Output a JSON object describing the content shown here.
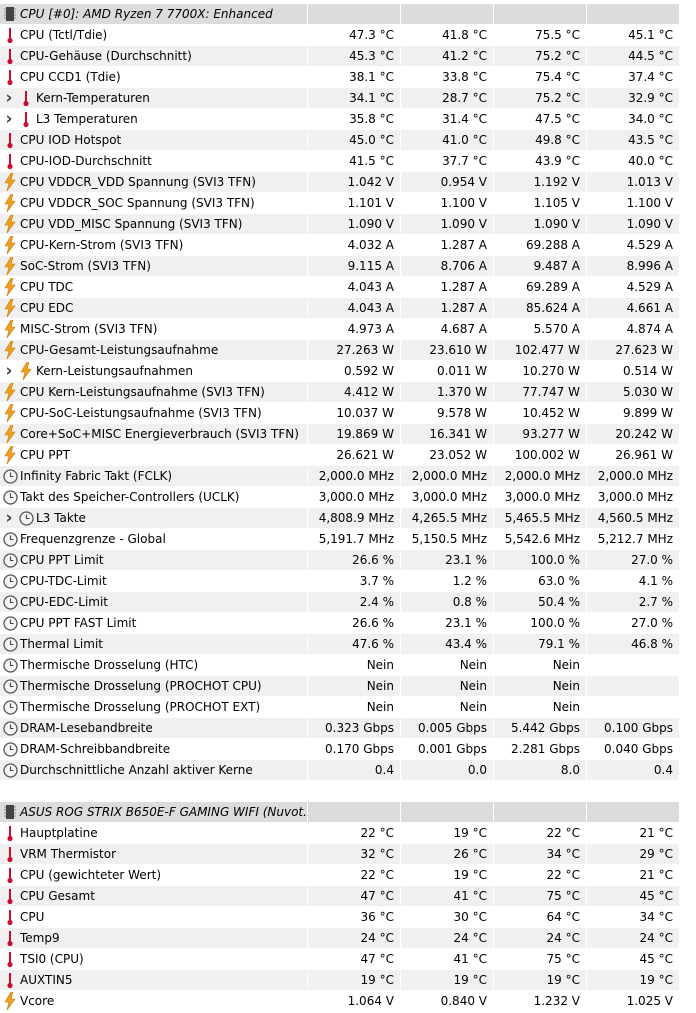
{
  "colors": {
    "row_alt": "#f0f0f0",
    "header": "#dcdcdc",
    "thermo": "#c8102e",
    "bolt": "#f0a020"
  },
  "sections": [
    {
      "title": "CPU [#0]: AMD Ryzen 7 7700X: Enhanced",
      "rows": [
        {
          "icon": "thermometer-icon",
          "label": "CPU (Tctl/Tdie)",
          "values": [
            "47.3 °C",
            "41.8 °C",
            "75.5 °C",
            "45.1 °C"
          ]
        },
        {
          "icon": "thermometer-icon",
          "label": "CPU-Gehäuse (Durchschnitt)",
          "values": [
            "45.3 °C",
            "41.2 °C",
            "75.2 °C",
            "44.5 °C"
          ]
        },
        {
          "icon": "thermometer-icon",
          "label": "CPU CCD1 (Tdie)",
          "values": [
            "38.1 °C",
            "33.8 °C",
            "75.4 °C",
            "37.4 °C"
          ]
        },
        {
          "icon": "thermometer-icon",
          "expand": true,
          "label": "Kern-Temperaturen",
          "values": [
            "34.1 °C",
            "28.7 °C",
            "75.2 °C",
            "32.9 °C"
          ]
        },
        {
          "icon": "thermometer-icon",
          "expand": true,
          "label": "L3 Temperaturen",
          "values": [
            "35.8 °C",
            "31.4 °C",
            "47.5 °C",
            "34.0 °C"
          ]
        },
        {
          "icon": "thermometer-icon",
          "label": "CPU IOD Hotspot",
          "values": [
            "45.0 °C",
            "41.0 °C",
            "49.8 °C",
            "43.5 °C"
          ]
        },
        {
          "icon": "thermometer-icon",
          "label": "CPU-IOD-Durchschnitt",
          "values": [
            "41.5 °C",
            "37.7 °C",
            "43.9 °C",
            "40.0 °C"
          ]
        },
        {
          "icon": "lightning-icon",
          "label": "CPU VDDCR_VDD Spannung (SVI3 TFN)",
          "values": [
            "1.042 V",
            "0.954 V",
            "1.192 V",
            "1.013 V"
          ]
        },
        {
          "icon": "lightning-icon",
          "label": "CPU VDDCR_SOC Spannung (SVI3 TFN)",
          "values": [
            "1.101 V",
            "1.100 V",
            "1.105 V",
            "1.100 V"
          ]
        },
        {
          "icon": "lightning-icon",
          "label": "CPU VDD_MISC Spannung (SVI3 TFN)",
          "values": [
            "1.090 V",
            "1.090 V",
            "1.090 V",
            "1.090 V"
          ]
        },
        {
          "icon": "lightning-icon",
          "label": "CPU-Kern-Strom (SVI3 TFN)",
          "values": [
            "4.032 A",
            "1.287 A",
            "69.288 A",
            "4.529 A"
          ]
        },
        {
          "icon": "lightning-icon",
          "label": "SoC-Strom (SVI3 TFN)",
          "values": [
            "9.115 A",
            "8.706 A",
            "9.487 A",
            "8.996 A"
          ]
        },
        {
          "icon": "lightning-icon",
          "label": "CPU TDC",
          "values": [
            "4.043 A",
            "1.287 A",
            "69.289 A",
            "4.529 A"
          ]
        },
        {
          "icon": "lightning-icon",
          "label": "CPU EDC",
          "values": [
            "4.043 A",
            "1.287 A",
            "85.624 A",
            "4.661 A"
          ]
        },
        {
          "icon": "lightning-icon",
          "label": "MISC-Strom (SVI3 TFN)",
          "values": [
            "4.973 A",
            "4.687 A",
            "5.570 A",
            "4.874 A"
          ]
        },
        {
          "icon": "lightning-icon",
          "label": "CPU-Gesamt-Leistungsaufnahme",
          "values": [
            "27.263 W",
            "23.610 W",
            "102.477 W",
            "27.623 W"
          ]
        },
        {
          "icon": "lightning-icon",
          "expand": true,
          "label": "Kern-Leistungsaufnahmen",
          "values": [
            "0.592 W",
            "0.011 W",
            "10.270 W",
            "0.514 W"
          ]
        },
        {
          "icon": "lightning-icon",
          "label": "CPU Kern-Leistungsaufnahme (SVI3 TFN)",
          "values": [
            "4.412 W",
            "1.370 W",
            "77.747 W",
            "5.030 W"
          ]
        },
        {
          "icon": "lightning-icon",
          "label": "CPU-SoC-Leistungsaufnahme (SVI3 TFN)",
          "values": [
            "10.037 W",
            "9.578 W",
            "10.452 W",
            "9.899 W"
          ]
        },
        {
          "icon": "lightning-icon",
          "label": "Core+SoC+MISC Energieverbrauch (SVI3 TFN)",
          "values": [
            "19.869 W",
            "16.341 W",
            "93.277 W",
            "20.242 W"
          ]
        },
        {
          "icon": "lightning-icon",
          "label": "CPU PPT",
          "values": [
            "26.621 W",
            "23.052 W",
            "100.002 W",
            "26.961 W"
          ]
        },
        {
          "icon": "clock-icon",
          "label": "Infinity Fabric Takt (FCLK)",
          "values": [
            "2,000.0 MHz",
            "2,000.0 MHz",
            "2,000.0 MHz",
            "2,000.0 MHz"
          ]
        },
        {
          "icon": "clock-icon",
          "label": "Takt des Speicher-Controllers (UCLK)",
          "values": [
            "3,000.0 MHz",
            "3,000.0 MHz",
            "3,000.0 MHz",
            "3,000.0 MHz"
          ]
        },
        {
          "icon": "clock-icon",
          "expand": true,
          "label": "L3 Takte",
          "values": [
            "4,808.9 MHz",
            "4,265.5 MHz",
            "5,465.5 MHz",
            "4,560.5 MHz"
          ]
        },
        {
          "icon": "clock-icon",
          "label": "Frequenzgrenze - Global",
          "values": [
            "5,191.7 MHz",
            "5,150.5 MHz",
            "5,542.6 MHz",
            "5,212.7 MHz"
          ]
        },
        {
          "icon": "clock-icon",
          "label": "CPU PPT Limit",
          "values": [
            "26.6 %",
            "23.1 %",
            "100.0 %",
            "27.0 %"
          ]
        },
        {
          "icon": "clock-icon",
          "label": "CPU-TDC-Limit",
          "values": [
            "3.7 %",
            "1.2 %",
            "63.0 %",
            "4.1 %"
          ]
        },
        {
          "icon": "clock-icon",
          "label": "CPU-EDC-Limit",
          "values": [
            "2.4 %",
            "0.8 %",
            "50.4 %",
            "2.7 %"
          ]
        },
        {
          "icon": "clock-icon",
          "label": "CPU PPT FAST Limit",
          "values": [
            "26.6 %",
            "23.1 %",
            "100.0 %",
            "27.0 %"
          ]
        },
        {
          "icon": "clock-icon",
          "label": "Thermal Limit",
          "values": [
            "47.6 %",
            "43.4 %",
            "79.1 %",
            "46.8 %"
          ]
        },
        {
          "icon": "clock-icon",
          "label": "Thermische Drosselung (HTC)",
          "values": [
            "Nein",
            "Nein",
            "Nein",
            ""
          ]
        },
        {
          "icon": "clock-icon",
          "label": "Thermische Drosselung (PROCHOT CPU)",
          "values": [
            "Nein",
            "Nein",
            "Nein",
            ""
          ]
        },
        {
          "icon": "clock-icon",
          "label": "Thermische Drosselung (PROCHOT EXT)",
          "values": [
            "Nein",
            "Nein",
            "Nein",
            ""
          ]
        },
        {
          "icon": "clock-icon",
          "label": "DRAM-Lesebandbreite",
          "values": [
            "0.323 Gbps",
            "0.005 Gbps",
            "5.442 Gbps",
            "0.100 Gbps"
          ]
        },
        {
          "icon": "clock-icon",
          "label": "DRAM-Schreibbandbreite",
          "values": [
            "0.170 Gbps",
            "0.001 Gbps",
            "2.281 Gbps",
            "0.040 Gbps"
          ]
        },
        {
          "icon": "clock-icon",
          "label": "Durchschnittliche Anzahl aktiver Kerne",
          "values": [
            "0.4",
            "0.0",
            "8.0",
            "0.4"
          ]
        }
      ]
    },
    {
      "title": "ASUS ROG STRIX B650E-F GAMING WIFI (Nuvot...",
      "rows": [
        {
          "icon": "thermometer-icon",
          "label": "Hauptplatine",
          "values": [
            "22 °C",
            "19 °C",
            "22 °C",
            "21 °C"
          ]
        },
        {
          "icon": "thermometer-icon",
          "label": "VRM Thermistor",
          "values": [
            "32 °C",
            "26 °C",
            "34 °C",
            "29 °C"
          ]
        },
        {
          "icon": "thermometer-icon",
          "label": "CPU (gewichteter Wert)",
          "values": [
            "22 °C",
            "19 °C",
            "22 °C",
            "21 °C"
          ]
        },
        {
          "icon": "thermometer-icon",
          "label": "CPU Gesamt",
          "values": [
            "47 °C",
            "41 °C",
            "75 °C",
            "45 °C"
          ]
        },
        {
          "icon": "thermometer-icon",
          "label": "CPU",
          "values": [
            "36 °C",
            "30 °C",
            "64 °C",
            "34 °C"
          ]
        },
        {
          "icon": "thermometer-icon",
          "label": "Temp9",
          "values": [
            "24 °C",
            "24 °C",
            "24 °C",
            "24 °C"
          ]
        },
        {
          "icon": "thermometer-icon",
          "label": "TSI0 (CPU)",
          "values": [
            "47 °C",
            "41 °C",
            "75 °C",
            "45 °C"
          ]
        },
        {
          "icon": "thermometer-icon",
          "label": "AUXTIN5",
          "values": [
            "19 °C",
            "19 °C",
            "19 °C",
            "19 °C"
          ]
        },
        {
          "icon": "lightning-icon",
          "label": "Vcore",
          "values": [
            "1.064 V",
            "0.840 V",
            "1.232 V",
            "1.025 V"
          ]
        }
      ]
    }
  ]
}
